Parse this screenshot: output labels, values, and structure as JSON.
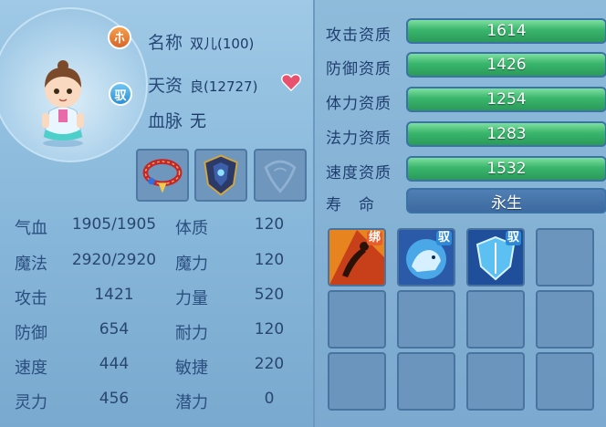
{
  "pet": {
    "name_label": "名称",
    "name_value": "双儿(100)",
    "talent_label": "天资",
    "talent_value": "良(12727)",
    "bloodline_label": "血脉",
    "bloodline_value": "无",
    "class_badge": "",
    "tame_badge": "驭"
  },
  "stats_left": [
    {
      "label": "气血",
      "value": "1905/1905"
    },
    {
      "label": "魔法",
      "value": "2920/2920"
    },
    {
      "label": "攻击",
      "value": "1421"
    },
    {
      "label": "防御",
      "value": "654"
    },
    {
      "label": "速度",
      "value": "444"
    },
    {
      "label": "灵力",
      "value": "456"
    }
  ],
  "stats_right": [
    {
      "label": "体质",
      "value": "120"
    },
    {
      "label": "魔力",
      "value": "120"
    },
    {
      "label": "力量",
      "value": "520"
    },
    {
      "label": "耐力",
      "value": "120"
    },
    {
      "label": "敏捷",
      "value": "220"
    },
    {
      "label": "潜力",
      "value": "0"
    }
  ],
  "aptitudes": [
    {
      "label": "攻击资质",
      "value": "1614"
    },
    {
      "label": "防御资质",
      "value": "1426"
    },
    {
      "label": "体力资质",
      "value": "1254"
    },
    {
      "label": "法力资质",
      "value": "1283"
    },
    {
      "label": "速度资质",
      "value": "1532"
    }
  ],
  "lifespan": {
    "label": "寿　命",
    "value": "永生"
  },
  "skills": [
    {
      "tag": "绑"
    },
    {
      "tag": "驭"
    },
    {
      "tag": "驭"
    }
  ],
  "colors": {
    "aptitude_bar": "#39b56c",
    "lifespan_bar": "#3d6aa0",
    "heart": "#e8506e"
  }
}
